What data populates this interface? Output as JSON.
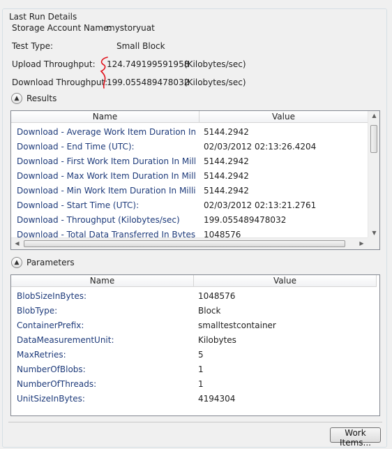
{
  "group": {
    "title": "Last Run Details"
  },
  "summary": {
    "storage_label": "Storage Account Name:",
    "storage_value": "mystoryuat",
    "testtype_label": "Test Type:",
    "testtype_value": "Small Block",
    "upload_label": "Upload Throughput:",
    "upload_value": "124.749199591958",
    "upload_unit": "(Kilobytes/sec)",
    "download_label": "Download Throughput:",
    "download_value": "199.055489478032",
    "download_unit": "(Kilobytes/sec)"
  },
  "results": {
    "title": "Results",
    "headers": {
      "name": "Name",
      "value": "Value"
    },
    "rows": [
      {
        "name": "Download - Average Work Item Duration In Milli",
        "value": "5144.2942"
      },
      {
        "name": "Download - End Time (UTC):",
        "value": "02/03/2012 02:13:26.4204"
      },
      {
        "name": "Download - First Work Item Duration In Millisecc",
        "value": "5144.2942"
      },
      {
        "name": "Download - Max Work Item Duration In Millisecc",
        "value": "5144.2942"
      },
      {
        "name": "Download - Min Work Item Duration In Millisecc",
        "value": "5144.2942"
      },
      {
        "name": "Download - Start Time (UTC):",
        "value": "02/03/2012 02:13:21.2761"
      },
      {
        "name": "Download - Throughput (Kilobytes/sec)",
        "value": "199.055489478032"
      },
      {
        "name": "Download - Total Data Transferred In Bytes:",
        "value": "1048576"
      }
    ]
  },
  "parameters": {
    "title": "Parameters",
    "headers": {
      "name": "Name",
      "value": "Value"
    },
    "rows": [
      {
        "name": "BlobSizeInBytes:",
        "value": "1048576"
      },
      {
        "name": "BlobType:",
        "value": "Block"
      },
      {
        "name": "ContainerPrefix:",
        "value": "smalltestcontainer"
      },
      {
        "name": "DataMeasurementUnit:",
        "value": "Kilobytes"
      },
      {
        "name": "MaxRetries:",
        "value": "5"
      },
      {
        "name": "NumberOfBlobs:",
        "value": "1"
      },
      {
        "name": "NumberOfThreads:",
        "value": "1"
      },
      {
        "name": "UnitSizeInBytes:",
        "value": "4194304"
      }
    ]
  },
  "buttons": {
    "work_items": "Work Items..."
  },
  "icons": {
    "collapse": "chevron-up-icon",
    "scroll_up": "arrow-up-icon",
    "scroll_down": "arrow-down-icon",
    "scroll_left": "arrow-left-icon",
    "scroll_right": "arrow-right-icon"
  },
  "colors": {
    "link_text": "#1d3a7a",
    "annotation": "#e0101a"
  }
}
